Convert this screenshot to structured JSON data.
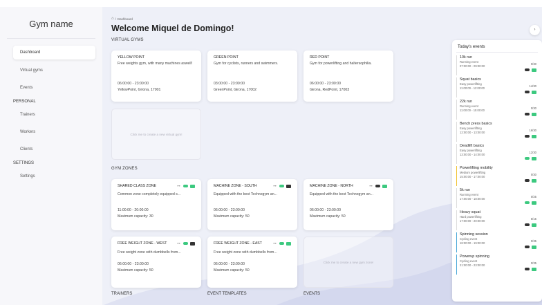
{
  "brand": "Gym name",
  "sidebar": {
    "items": [
      {
        "label": "Dashboard"
      },
      {
        "label": "Virtual gyms"
      },
      {
        "label": "Events"
      }
    ],
    "section_personal": "PERSONAL",
    "personal_items": [
      {
        "label": "Trainers"
      },
      {
        "label": "Workers"
      },
      {
        "label": "Clients"
      }
    ],
    "section_settings": "SETTINGS",
    "settings_items": [
      {
        "label": "Settings"
      }
    ]
  },
  "breadcrumb": {
    "icon": "home-icon",
    "separator": "/",
    "current": "Dashboard"
  },
  "welcome": "Welcome Miquel de Domingo!",
  "virtual_gyms": {
    "title": "VIRTUAL GYMS",
    "cards": [
      {
        "name": "YELLOW POINT",
        "desc": "Free weights gym, with many machines aswell!",
        "time": "06:00:00 - 23:00:00",
        "place": "YellowPoint, Girona, 17001"
      },
      {
        "name": "GREEN POINT",
        "desc": "Gym for cyclists, runners and swimmers.",
        "time": "03:00:00 - 23:00:00",
        "place": "GreenPoint, Girona, 17002"
      },
      {
        "name": "RED POINT",
        "desc": "Gym for powerlifting and haltersophilia.",
        "time": "06:00:00 - 23:00:00",
        "place": "Girona, RedPoint, 17003"
      }
    ],
    "create_label": "Click me to create a new virtual gym!"
  },
  "gym_zones": {
    "title": "GYM ZONES",
    "cards": [
      {
        "name": "SHARED CLASS ZONE",
        "desc": "Common zone completely equipped s...",
        "time": "11:00:00 - 20:00:00",
        "cap": "Maximum capacity: 30"
      },
      {
        "name": "MACHINE ZONE - SOUTH",
        "desc": "Equipped with the best Technogym an...",
        "time": "06:00:00 - 23:00:00",
        "cap": "Maximum capacity: 50"
      },
      {
        "name": "MACHINE ZONE - NORTH",
        "desc": "Equipped with the best Technogym an...",
        "time": "06:00:00 - 23:00:00",
        "cap": "Maximum capacity: 50"
      },
      {
        "name": "FREE WEIGHT ZONE - WEST",
        "desc": "Free weight zone with dumbbells from...",
        "time": "06:00:00 - 23:00:00",
        "cap": "Maximum capacity: 50"
      },
      {
        "name": "FREE WEIGHT ZONE - EAST",
        "desc": "Free weight zone with dumbbells from...",
        "time": "06:00:00 - 23:00:00",
        "cap": "Maximum capacity: 50"
      }
    ],
    "create_label": "Click me to create a new gym zone!"
  },
  "bottom_sections": [
    "TRAINERS",
    "EVENT TEMPLATES",
    "EVENTS"
  ],
  "toggle_icon": "chevron-right-icon",
  "toggle_glyph": "›",
  "todays_events": {
    "title": "Today's events",
    "events": [
      {
        "name": "10k run",
        "type": "Running event",
        "time": "07:00:00 - 09:00:00",
        "count": "0/30"
      },
      {
        "name": "Squat basics",
        "type": "Easy powerlifting",
        "time": "11:00:00 - 12:00:00",
        "count": "14/30"
      },
      {
        "name": "22k run",
        "type": "Running event",
        "time": "11:00:00 - 15:00:00",
        "count": "0/30"
      },
      {
        "name": "Bench press basics",
        "type": "Easy powerlifting",
        "time": "12:00:00 - 13:00:00",
        "count": "16/30"
      },
      {
        "name": "Deadlift basics",
        "type": "Easy powerlifting",
        "time": "13:00:00 - 14:00:00",
        "count": "12/30"
      },
      {
        "name": "Powerlifting mobility",
        "type": "Medium powerlifting",
        "time": "15:00:00 - 17:00:00",
        "count": "0/30"
      },
      {
        "name": "5k run",
        "type": "Running event",
        "time": "17:00:00 - 18:00:00",
        "count": "0/25"
      },
      {
        "name": "Heavy squat",
        "type": "Hard powerlifting",
        "time": "17:00:00 - 20:00:00",
        "count": "5/15"
      },
      {
        "name": "Spinning session",
        "type": "Cycling event",
        "time": "18:00:00 - 19:00:00",
        "count": "0/35"
      },
      {
        "name": "Powerup spinning",
        "type": "Cycling event",
        "time": "21:00:00 - 23:00:00",
        "count": "0/35"
      }
    ]
  },
  "colors": {
    "accent_green": "#3cc97f",
    "yellow_marker": "#f1c232",
    "blue_marker": "#4aa8d8"
  }
}
